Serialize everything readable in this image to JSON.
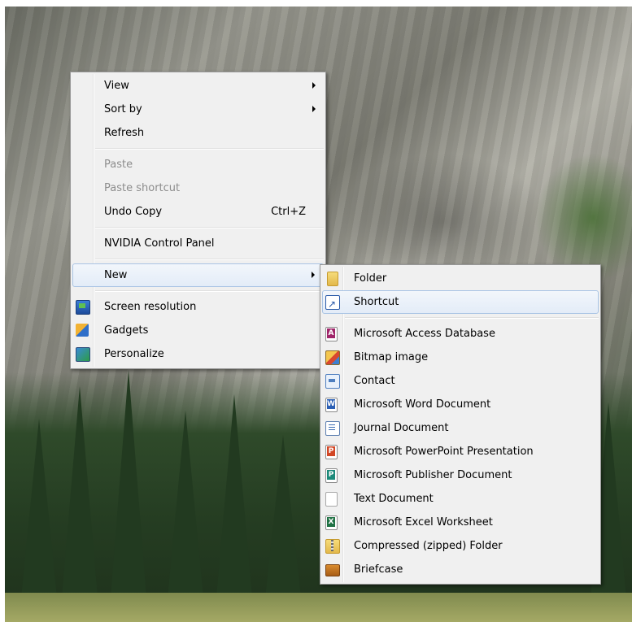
{
  "context_menu": {
    "view": "View",
    "sort_by": "Sort by",
    "refresh": "Refresh",
    "paste": "Paste",
    "paste_shortcut": "Paste shortcut",
    "undo_copy": "Undo Copy",
    "undo_copy_shortcut": "Ctrl+Z",
    "nvidia": "NVIDIA Control Panel",
    "new": "New",
    "screen_resolution": "Screen resolution",
    "gadgets": "Gadgets",
    "personalize": "Personalize"
  },
  "new_submenu": {
    "folder": "Folder",
    "shortcut": "Shortcut",
    "access": "Microsoft Access Database",
    "bitmap": "Bitmap image",
    "contact": "Contact",
    "word": "Microsoft Word Document",
    "journal": "Journal Document",
    "powerpoint": "Microsoft PowerPoint Presentation",
    "publisher": "Microsoft Publisher Document",
    "text": "Text Document",
    "excel": "Microsoft Excel Worksheet",
    "zip": "Compressed (zipped) Folder",
    "briefcase": "Briefcase"
  },
  "icons": {
    "screen_resolution": "screen-resolution-icon",
    "gadgets": "gadgets-icon",
    "personalize": "personalize-icon",
    "folder": "folder-icon",
    "shortcut": "shortcut-icon",
    "access": "access-icon",
    "bitmap": "bitmap-icon",
    "contact": "contact-icon",
    "word": "word-icon",
    "journal": "journal-icon",
    "powerpoint": "powerpoint-icon",
    "publisher": "publisher-icon",
    "text": "text-document-icon",
    "excel": "excel-icon",
    "zip": "zip-folder-icon",
    "briefcase": "briefcase-icon"
  },
  "colors": {
    "menu_bg": "#f0f0f0",
    "menu_border": "#979797",
    "highlight_border": "#a9c4e4",
    "disabled_text": "#8d8d8d"
  }
}
